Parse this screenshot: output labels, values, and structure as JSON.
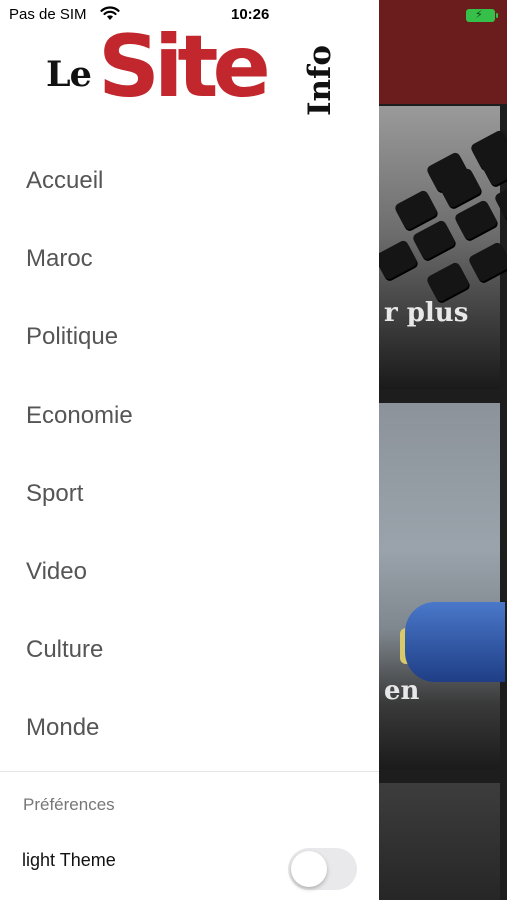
{
  "status_bar": {
    "carrier": "Pas de SIM",
    "time": "10:26",
    "wifi_icon": "wifi-icon",
    "battery_icon": "battery-charging-icon"
  },
  "logo": {
    "le": "Le",
    "site": "Site",
    "info": "Info",
    "brand_red": "#c1272d"
  },
  "menu": {
    "items": [
      {
        "label": "Accueil"
      },
      {
        "label": "Maroc"
      },
      {
        "label": "Politique"
      },
      {
        "label": "Economie"
      },
      {
        "label": "Sport"
      },
      {
        "label": "Video"
      },
      {
        "label": "Culture"
      },
      {
        "label": "Monde"
      }
    ]
  },
  "preferences": {
    "title": "Préférences",
    "light_theme_label": "light Theme",
    "light_theme_on": false
  },
  "background": {
    "header_color": "#6b1c1c",
    "headline_1_fragment": "r plus",
    "headline_2_fragment": "en"
  }
}
